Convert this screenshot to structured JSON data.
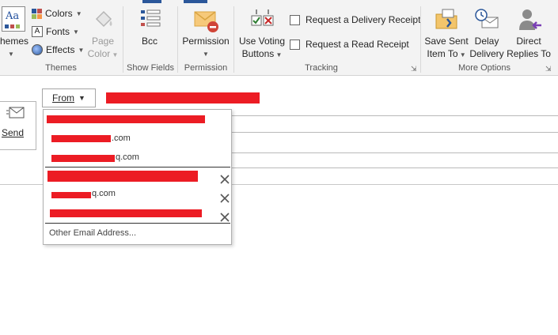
{
  "ribbon": {
    "themes": {
      "label": "hemes",
      "group_label": "Themes"
    },
    "colors": {
      "label": "Colors"
    },
    "fonts": {
      "label": "Fonts"
    },
    "effects": {
      "label": "Effects"
    },
    "page_color": {
      "label_line1": "Page",
      "label_line2": "Color"
    },
    "bcc": {
      "label": "Bcc",
      "group_label": "Show Fields"
    },
    "permission": {
      "label": "Permission",
      "group_label": "Permission"
    },
    "voting": {
      "label_line1": "Use Voting",
      "label_line2": "Buttons"
    },
    "tracking": {
      "delivery_receipt": "Request a Delivery Receipt",
      "read_receipt": "Request a Read Receipt",
      "group_label": "Tracking"
    },
    "more_options": {
      "save_sent_line1": "Save Sent",
      "save_sent_line2": "Item To",
      "delay_line1": "Delay",
      "delay_line2": "Delivery",
      "direct_line1": "Direct",
      "direct_line2": "Replies To",
      "group_label": "More Options"
    }
  },
  "compose": {
    "from_label": "From",
    "send_label": "Send"
  },
  "from_dropdown": {
    "accounts": [
      {
        "suffix": ".com"
      },
      {
        "suffix": "q.com"
      },
      {
        "suffix": "q.com"
      }
    ],
    "other_email_label": "Other Email Address..."
  },
  "colors": {
    "accent": "#2b579a",
    "redaction": "#ec1c24"
  }
}
